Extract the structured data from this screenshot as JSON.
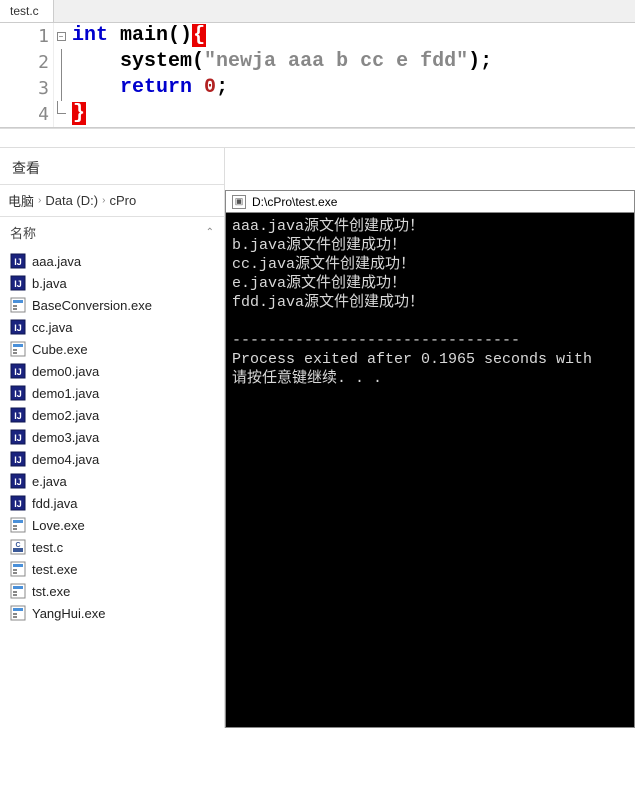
{
  "editor": {
    "tab_label": "test.c",
    "line1": "int main(){",
    "line2": "    system(\"newja aaa b cc e fdd\");",
    "line3": "    return 0;",
    "line4": "}"
  },
  "explorer": {
    "view_label": "查看",
    "breadcrumb": [
      "电脑",
      "Data (D:)",
      "cPro"
    ],
    "column_header": "名称",
    "files": [
      {
        "name": "aaa.java",
        "type": "java"
      },
      {
        "name": "b.java",
        "type": "java"
      },
      {
        "name": "BaseConversion.exe",
        "type": "exe"
      },
      {
        "name": "cc.java",
        "type": "java"
      },
      {
        "name": "Cube.exe",
        "type": "exe"
      },
      {
        "name": "demo0.java",
        "type": "java"
      },
      {
        "name": "demo1.java",
        "type": "java"
      },
      {
        "name": "demo2.java",
        "type": "java"
      },
      {
        "name": "demo3.java",
        "type": "java"
      },
      {
        "name": "demo4.java",
        "type": "java"
      },
      {
        "name": "e.java",
        "type": "java"
      },
      {
        "name": "fdd.java",
        "type": "java"
      },
      {
        "name": "Love.exe",
        "type": "exe"
      },
      {
        "name": "test.c",
        "type": "c"
      },
      {
        "name": "test.exe",
        "type": "exe"
      },
      {
        "name": "tst.exe",
        "type": "exe"
      },
      {
        "name": "YangHui.exe",
        "type": "exe"
      }
    ]
  },
  "terminal": {
    "title": "D:\\cPro\\test.exe",
    "lines": [
      "aaa.java源文件创建成功！",
      "b.java源文件创建成功！",
      "cc.java源文件创建成功！",
      "e.java源文件创建成功！",
      "fdd.java源文件创建成功！",
      "",
      "--------------------------------",
      "Process exited after 0.1965 seconds with",
      "请按任意键继续. . ."
    ]
  }
}
